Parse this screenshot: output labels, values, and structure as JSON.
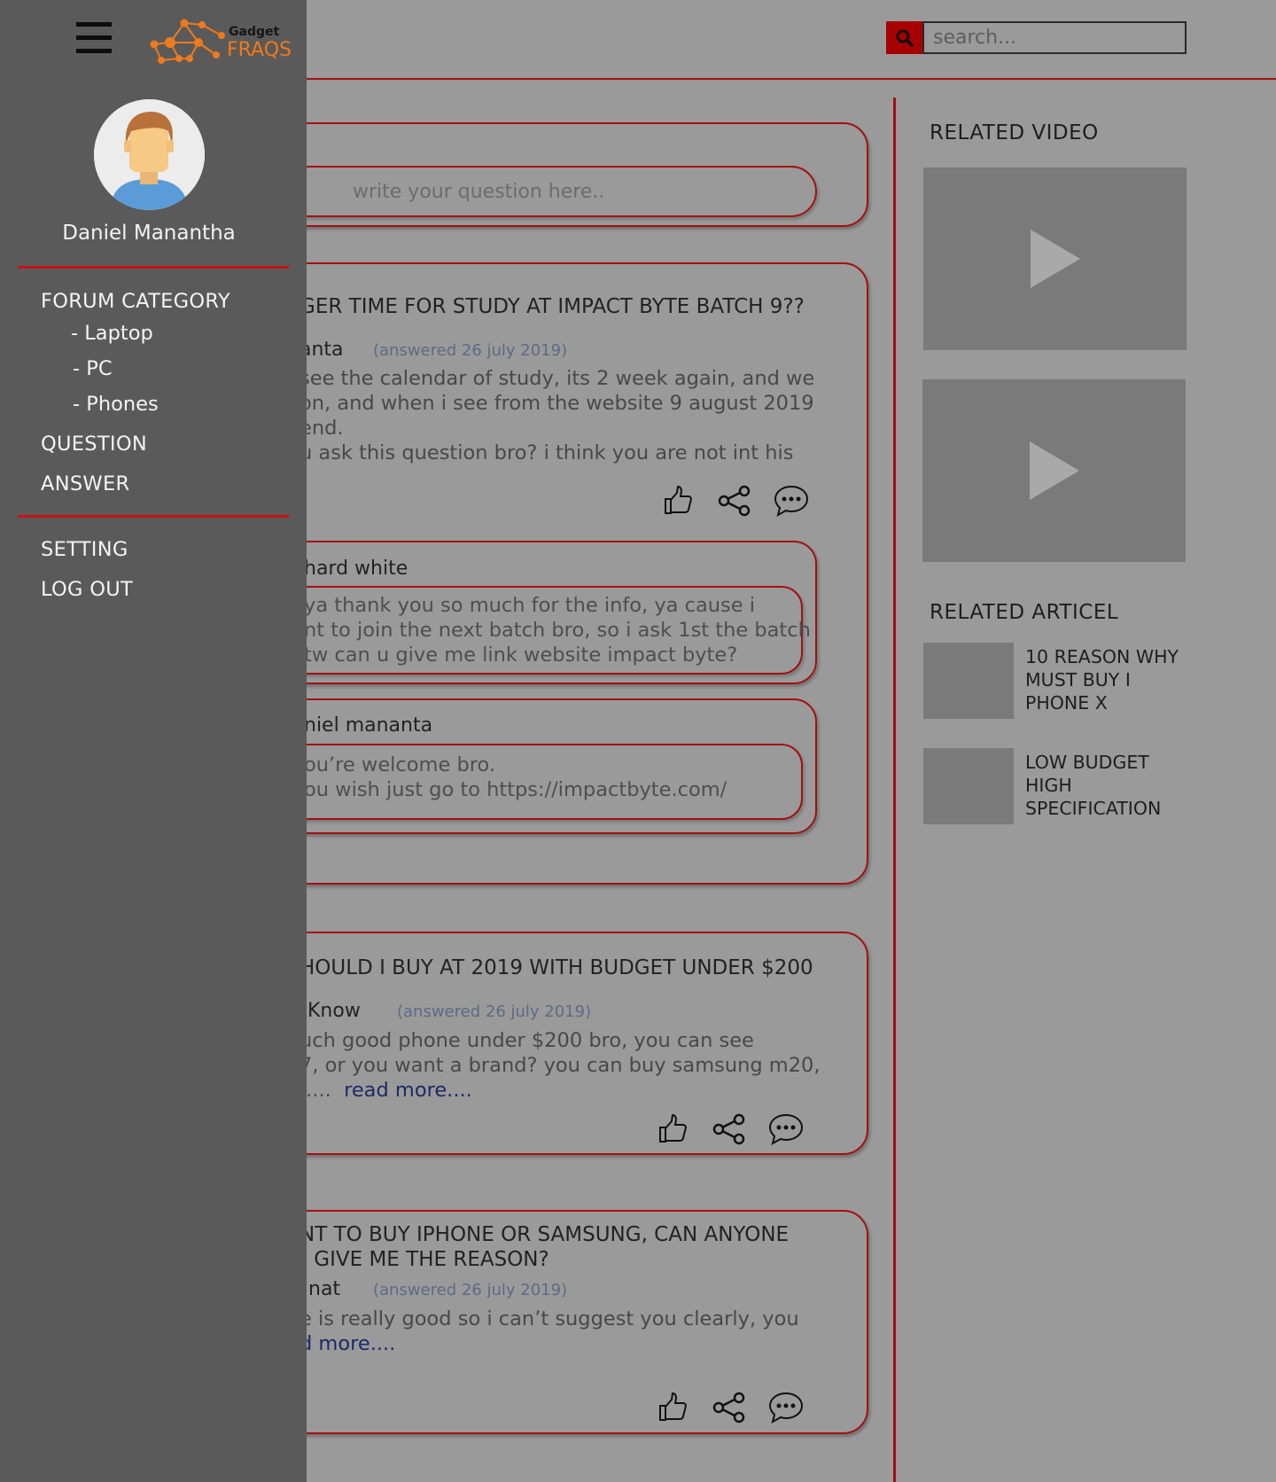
{
  "sidebar": {
    "logo": {
      "top": "Gadget",
      "bottom": "FRAQS"
    },
    "user_name": "Daniel Manantha",
    "forum_category": "FORUM CATEGORY",
    "categories": [
      "- Laptop",
      "- PC",
      "- Phones"
    ],
    "question": "QUESTION",
    "answer": "ANSWER",
    "setting": "SETTING",
    "logout": "LOG OUT"
  },
  "header": {
    "search_placeholder": "search..."
  },
  "ask": {
    "placeholder": "write your question here.."
  },
  "questions": [
    {
      "title": "GER TIME FOR STUDY  AT IMPACT BYTE BATCH 9??",
      "author": "anta",
      "date": "(answered 26 july 2019)",
      "body": [
        "see the calendar of study, its 2 week again, and we",
        "on, and when i see from the website 9 august 2019",
        "end.",
        "u ask this question bro? i think you are not int his"
      ],
      "replies": [
        {
          "name": "hard white",
          "text": [
            "ya thank you so much for the info, ya cause i",
            "nt to join the next batch bro, so i ask 1st the batch",
            "tw can u give me link website impact byte?"
          ]
        },
        {
          "name": "niel mananta",
          "text": [
            "ou’re welcome bro.",
            "ou wish just go to https://impactbyte.com/"
          ]
        }
      ]
    },
    {
      "title": "HOULD I BUY AT 2019 WITH BUDGET UNDER $200",
      "author": "Know",
      "date": "(answered 26 july 2019)",
      "body": [
        "uch good phone under $200 bro, you can see",
        "7, or you want a brand? you can buy samsung m20,"
      ],
      "body_tail": ".....",
      "read_more": "read more...."
    },
    {
      "title": [
        "NT TO BUY IPHONE OR SAMSUNG, CAN ANYONE",
        ") GIVE ME THE REASON?"
      ],
      "author": "nat",
      "date": "(answered 26 july 2019)",
      "body": [
        "e is really good so i can’t suggest you clearly, you"
      ],
      "read_more": "d more...."
    }
  ],
  "related": {
    "video_title": "RELATED VIDEO",
    "article_title": "RELATED ARTICEL",
    "articles": [
      "10 REASON WHY MUST BUY I PHONE X",
      "LOW BUDGET HIGH SPECIFICATION"
    ]
  },
  "colors": {
    "accent_red": "#a31010",
    "search_button": "#a60000",
    "logo_orange": "#ef7a1c",
    "sidebar_bg": "#5a5a5a",
    "page_bg": "#9a9a9a"
  },
  "icons": [
    "menu-icon",
    "search-icon",
    "thumbs-up-icon",
    "share-icon",
    "comment-icon",
    "play-icon"
  ]
}
